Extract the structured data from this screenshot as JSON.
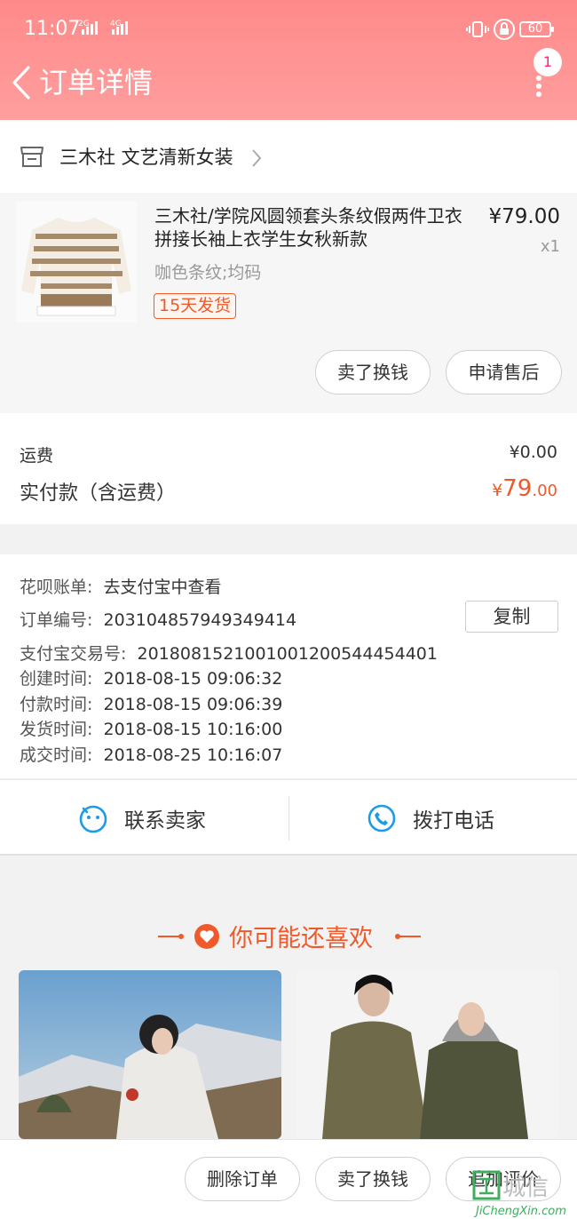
{
  "status_bar": {
    "time": "11:07",
    "sig1": "2G",
    "sig2": "4G",
    "battery": "60"
  },
  "header": {
    "title": "订单详情",
    "badge": "1"
  },
  "shop": {
    "name": "三木社 文艺清新女装"
  },
  "item": {
    "title": "三木社/学院风圆领套头条纹假两件卫衣拼接长袖上衣学生女秋新款",
    "sku": "咖色条纹;均码",
    "tag": "15天发货",
    "price": "¥79.00",
    "qty": "x1",
    "btn_sell": "卖了换钱",
    "btn_after_sale": "申请售后"
  },
  "fees": {
    "shipping_label": "运费",
    "shipping_value": "¥0.00",
    "paid_label": "实付款（含运费）",
    "paid_symbol": "¥",
    "paid_int": "79",
    "paid_dec": ".00"
  },
  "info": {
    "rows": [
      {
        "label": "花呗账单:",
        "value": "去支付宝中查看"
      },
      {
        "label": "订单编号:",
        "value": "203104857949349414"
      },
      {
        "label": "支付宝交易号:",
        "value": "2018081521001001200544454401"
      },
      {
        "label": "创建时间:",
        "value": "2018-08-15 09:06:32"
      },
      {
        "label": "付款时间:",
        "value": "2018-08-15 09:06:39"
      },
      {
        "label": "发货时间:",
        "value": "2018-08-15 10:16:00"
      },
      {
        "label": "成交时间:",
        "value": "2018-08-25 10:16:07"
      }
    ],
    "copy_label": "复制"
  },
  "contact": {
    "seller_label": "联系卖家",
    "call_label": "拨打电话"
  },
  "recommend": {
    "title": "你可能还喜欢"
  },
  "bottom": {
    "delete_label": "删除订单",
    "sell_label": "卖了换钱",
    "review_label": "追加评价"
  },
  "watermark": {
    "cn": "城信",
    "en": "JiChengXin.com"
  },
  "colors": {
    "header": "#ff8a8a",
    "accent": "#f05a2a",
    "icon_blue": "#1e9be6"
  }
}
